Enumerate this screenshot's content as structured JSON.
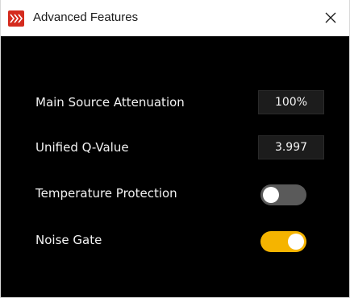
{
  "window": {
    "title": "Advanced Features",
    "app_icon": "red-speaker-logo-icon",
    "close_icon": "close-icon"
  },
  "settings": [
    {
      "label": "Main Source Attenuation",
      "type": "value",
      "value": "100%"
    },
    {
      "label": "Unified Q-Value",
      "type": "value",
      "value": "3.997"
    },
    {
      "label": "Temperature Protection",
      "type": "toggle",
      "enabled": false
    },
    {
      "label": "Noise Gate",
      "type": "toggle",
      "enabled": true
    }
  ],
  "colors": {
    "background": "#000000",
    "toggle_on": "#f5b400",
    "toggle_off": "#5a5a5a",
    "value_box": "#1c1c1c",
    "app_icon_red": "#d42b1e"
  }
}
